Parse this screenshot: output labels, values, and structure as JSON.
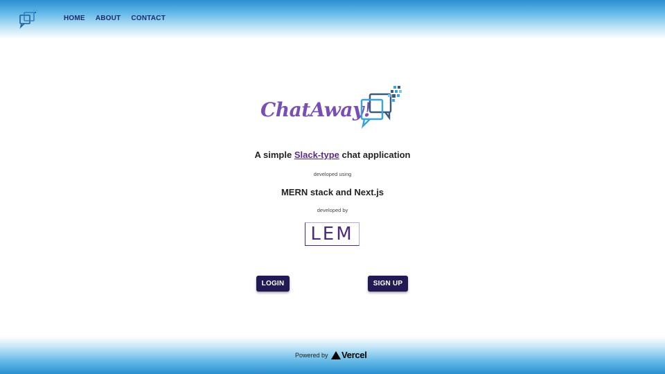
{
  "header": {
    "logo_icon": "chat-bubbles-icon",
    "nav": {
      "home": "HOME",
      "about": "ABOUT",
      "contact": "CONTACT"
    }
  },
  "hero": {
    "brand_name": "ChatAway!",
    "brand_icon": "chat-bubbles-icon",
    "tagline_prefix": "A simple ",
    "tagline_link": "Slack-type",
    "tagline_suffix": " chat application",
    "developed_using_label": "developed using",
    "stack": "MERN stack and Next.js",
    "developed_by_label": "developed by",
    "developer_logo_text": "LEM"
  },
  "actions": {
    "login": "LOGIN",
    "signup": "SIGN UP"
  },
  "footer": {
    "powered_by": "Powered by",
    "provider": "Vercel",
    "provider_icon": "vercel-triangle-icon"
  },
  "colors": {
    "header_blue": "#2b8fd0",
    "brand_purple": "#7a4fb3",
    "button_navy": "#221a55",
    "link_purple": "#5a2a86"
  }
}
